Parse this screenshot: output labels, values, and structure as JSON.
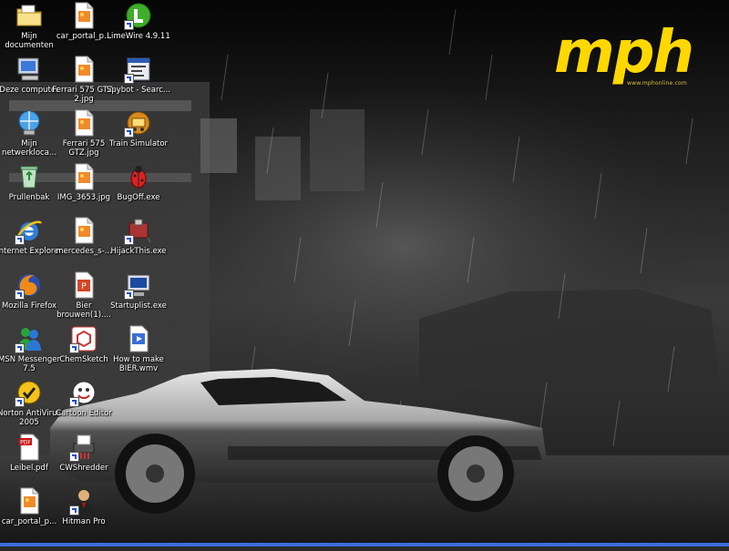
{
  "wallpaper": {
    "brand_text": "mph",
    "brand_url": "www.mphonline.com",
    "brand_color": "#ffd800"
  },
  "desktop_icons": [
    {
      "label": "Mijn documenten",
      "icon": "folder-documents-icon"
    },
    {
      "label": "car_portal_p...",
      "icon": "image-file-icon"
    },
    {
      "label": "LimeWire 4.9.11",
      "icon": "limewire-icon"
    },
    {
      "label": "Deze computer",
      "icon": "computer-icon"
    },
    {
      "label": "Ferrari 575 GTZ-2.jpg",
      "icon": "image-file-icon"
    },
    {
      "label": "Spybot - Searc...",
      "icon": "spybot-icon"
    },
    {
      "label": "Mijn netwerkloca...",
      "icon": "network-places-icon"
    },
    {
      "label": "Ferrari 575 GTZ.jpg",
      "icon": "image-file-icon"
    },
    {
      "label": "Train Simulator",
      "icon": "train-simulator-icon"
    },
    {
      "label": "Prullenbak",
      "icon": "recycle-bin-icon"
    },
    {
      "label": "IMG_3653.jpg",
      "icon": "image-file-icon"
    },
    {
      "label": "BugOff.exe",
      "icon": "bug-icon"
    },
    {
      "label": "Internet Explorer",
      "icon": "internet-explorer-icon"
    },
    {
      "label": "mercedes_s-...",
      "icon": "image-file-icon"
    },
    {
      "label": "HijackThis.exe",
      "icon": "hijackthis-icon"
    },
    {
      "label": "Mozilla Firefox",
      "icon": "firefox-icon"
    },
    {
      "label": "Bier brouwen(1)....",
      "icon": "powerpoint-file-icon"
    },
    {
      "label": "Startuplist.exe",
      "icon": "startuplist-icon"
    },
    {
      "label": "MSN Messenger 7.5",
      "icon": "msn-messenger-icon"
    },
    {
      "label": "ChemSketch",
      "icon": "chemsketch-icon"
    },
    {
      "label": "How to make BIER.wmv",
      "icon": "video-file-icon"
    },
    {
      "label": "Norton AntiVirus 2005",
      "icon": "norton-antivirus-icon"
    },
    {
      "label": "Cartoon Editor",
      "icon": "cartoon-editor-icon"
    },
    {
      "label": "Leibel.pdf",
      "icon": "pdf-file-icon"
    },
    {
      "label": "CWShredder",
      "icon": "cwshredder-icon"
    },
    {
      "label": "car_portal_p...",
      "icon": "image-file-icon"
    },
    {
      "label": "Hitman Pro",
      "icon": "hitman-pro-icon"
    }
  ]
}
